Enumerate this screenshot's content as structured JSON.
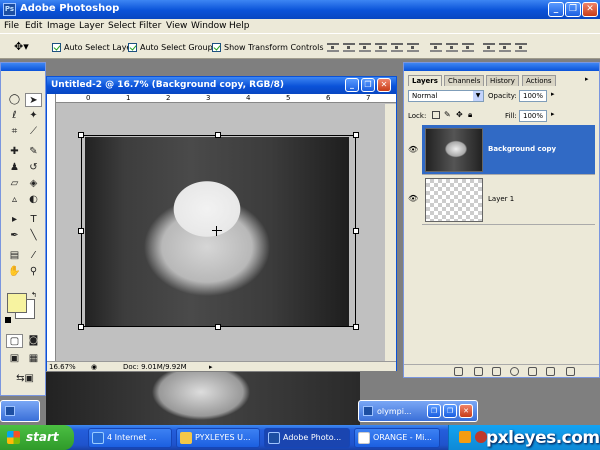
{
  "app": {
    "title": "Adobe Photoshop",
    "icon": "photoshop-icon"
  },
  "window_controls": {
    "minimize": "_",
    "restore": "❐",
    "close": "✕"
  },
  "menu": [
    "File",
    "Edit",
    "Image",
    "Layer",
    "Select",
    "Filter",
    "View",
    "Window",
    "Help"
  ],
  "options": {
    "auto_select_layer": "Auto Select Layer",
    "auto_select_groups": "Auto Select Groups",
    "show_transform_controls": "Show Transform Controls"
  },
  "document": {
    "title": "Untitled-2 @ 16.7% (Background copy, RGB/8)",
    "zoom": "16.67%",
    "doc_info": "Doc: 9.01M/9.92M",
    "ruler_h": [
      "0",
      "1",
      "2",
      "3",
      "4",
      "5",
      "6",
      "7"
    ]
  },
  "layers_panel": {
    "tabs": [
      "Layers",
      "Channels",
      "History",
      "Actions"
    ],
    "blend_mode": "Normal",
    "opacity_label": "Opacity:",
    "opacity_value": "100%",
    "lock_label": "Lock:",
    "fill_label": "Fill:",
    "fill_value": "100%",
    "layers": [
      {
        "name": "Background copy",
        "selected": true
      },
      {
        "name": "Layer 1",
        "selected": false
      }
    ]
  },
  "minimized": {
    "olympic_title": "olympi..."
  },
  "taskbar": {
    "start": "start",
    "items": [
      {
        "label": "4 Internet ...",
        "active": false
      },
      {
        "label": "PYXLEYES U...",
        "active": false
      },
      {
        "label": "Adobe Photo...",
        "active": true
      },
      {
        "label": "ORANGE - Mi...",
        "active": false
      }
    ]
  },
  "watermark": "pxleyes.com",
  "colors": {
    "foreground": "#f7f3a0",
    "background": "#ffffff",
    "selection": "#316ac5"
  }
}
